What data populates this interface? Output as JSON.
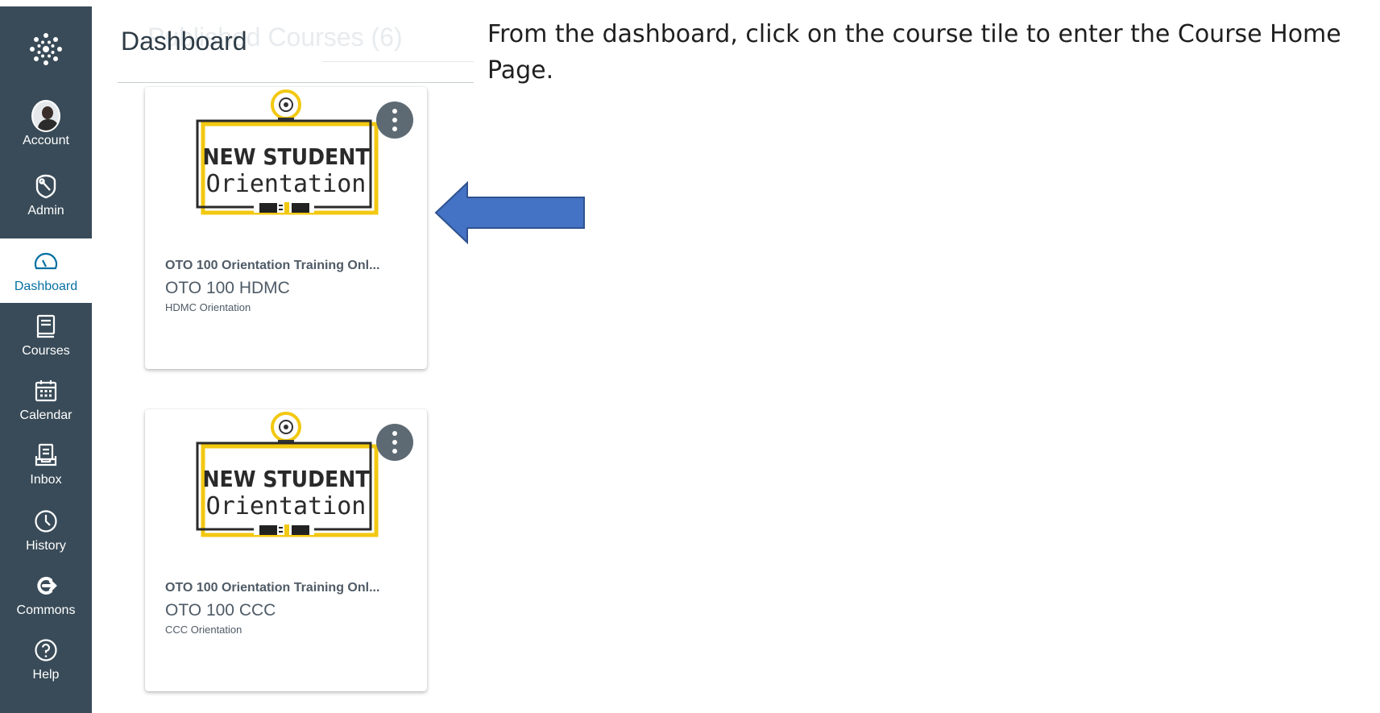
{
  "nav": {
    "items": [
      {
        "id": "account",
        "label": "Account"
      },
      {
        "id": "admin",
        "label": "Admin"
      },
      {
        "id": "dashboard",
        "label": "Dashboard"
      },
      {
        "id": "courses",
        "label": "Courses"
      },
      {
        "id": "calendar",
        "label": "Calendar"
      },
      {
        "id": "inbox",
        "label": "Inbox"
      },
      {
        "id": "history",
        "label": "History"
      },
      {
        "id": "commons",
        "label": "Commons"
      },
      {
        "id": "help",
        "label": "Help"
      }
    ],
    "active": "Dashboard",
    "colors": {
      "background": "#394b58",
      "active_text": "#0770a3",
      "text": "#ffffff"
    }
  },
  "header": {
    "title": "Dashboard",
    "ghost_title": "Published Courses (6)"
  },
  "cards": [
    {
      "hero_line1": "NEW STUDENT",
      "hero_line2": "Orientation",
      "link": "OTO 100 Orientation Training Onl...",
      "code": "OTO 100 HDMC",
      "term": "HDMC Orientation"
    },
    {
      "hero_line1": "NEW STUDENT",
      "hero_line2": "Orientation",
      "link": "OTO 100 Orientation Training Onl...",
      "code": "OTO 100 CCC",
      "term": "CCC Orientation"
    }
  ],
  "instruction": {
    "text": "From the dashboard, click on the course tile to enter the Course Home Page."
  },
  "colors": {
    "arrow_fill": "#4472c4",
    "arrow_stroke": "#2f528f",
    "hero_frame": "#f2c811",
    "menu_button": "#5e6a73"
  }
}
